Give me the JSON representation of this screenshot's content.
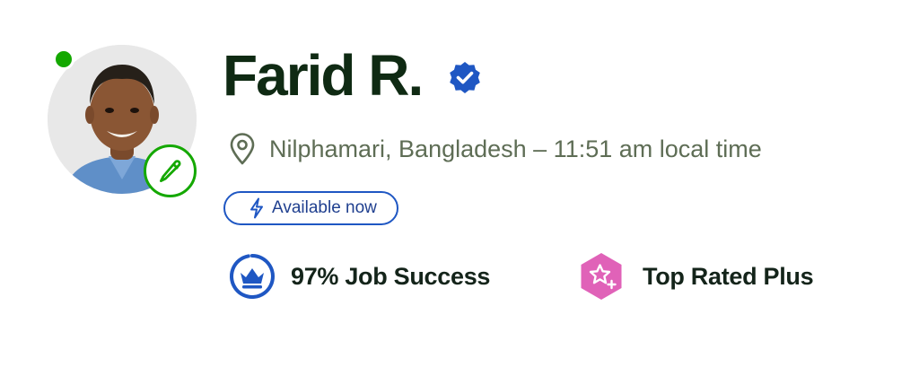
{
  "profile": {
    "name": "Farid R.",
    "location": "Nilphamari, Bangladesh – 11:51 am local time",
    "availability": "Available now",
    "online": true,
    "verified": true
  },
  "stats": {
    "job_success": {
      "label": "97% Job Success",
      "value_percent": 97,
      "icon": "crown-icon"
    },
    "top_rated": {
      "label": "Top Rated Plus",
      "icon": "top-rated-plus-star-icon"
    }
  },
  "colors": {
    "online": "#14a800",
    "verified": "#1f57c3",
    "availability": "#1f57c3",
    "job_success": "#1f57c3",
    "top_rated": "#e062b8",
    "name": "#0f2a13",
    "location": "#5e6d55"
  },
  "icons": {
    "avatar_edit": "pencil-icon",
    "verified": "verified-badge-icon",
    "location": "location-pin-icon",
    "availability": "lightning-bolt-icon"
  }
}
